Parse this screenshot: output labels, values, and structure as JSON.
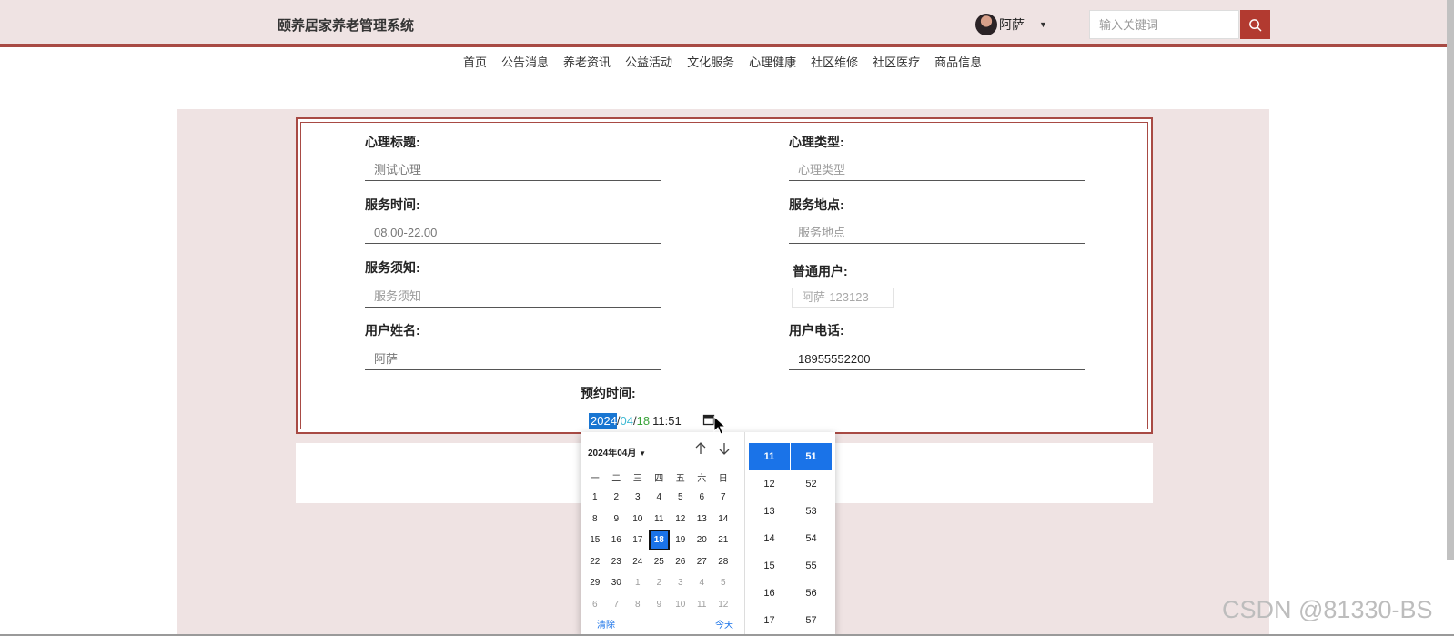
{
  "header": {
    "brand": "颐养居家养老管理系统",
    "username": "阿萨",
    "search_placeholder": "输入关键词"
  },
  "nav": [
    "首页",
    "公告消息",
    "养老资讯",
    "公益活动",
    "文化服务",
    "心理健康",
    "社区维修",
    "社区医疗",
    "商品信息"
  ],
  "form": {
    "title_label": "心理标题:",
    "title_value": "测试心理",
    "type_label": "心理类型:",
    "type_placeholder": "心理类型",
    "time_label": "服务时间:",
    "time_value": "08.00-22.00",
    "location_label": "服务地点:",
    "location_placeholder": "服务地点",
    "notice_label": "服务须知:",
    "notice_placeholder": "服务须知",
    "user_label": "普通用户:",
    "user_value": "阿萨-123123",
    "name_label": "用户姓名:",
    "name_value": "阿萨",
    "phone_label": "用户电话:",
    "phone_value": "18955552200",
    "appt_label": "预约时间:",
    "appt_year": "2024",
    "appt_month": "04",
    "appt_day": "18",
    "appt_time": "11:51"
  },
  "picker": {
    "month_label": "2024年04月",
    "weekdays": [
      "一",
      "二",
      "三",
      "四",
      "五",
      "六",
      "日"
    ],
    "days": [
      {
        "d": "1"
      },
      {
        "d": "2"
      },
      {
        "d": "3"
      },
      {
        "d": "4"
      },
      {
        "d": "5"
      },
      {
        "d": "6"
      },
      {
        "d": "7"
      },
      {
        "d": "8"
      },
      {
        "d": "9"
      },
      {
        "d": "10"
      },
      {
        "d": "11"
      },
      {
        "d": "12"
      },
      {
        "d": "13"
      },
      {
        "d": "14"
      },
      {
        "d": "15"
      },
      {
        "d": "16"
      },
      {
        "d": "17"
      },
      {
        "d": "18",
        "selected": true
      },
      {
        "d": "19"
      },
      {
        "d": "20"
      },
      {
        "d": "21"
      },
      {
        "d": "22"
      },
      {
        "d": "23"
      },
      {
        "d": "24"
      },
      {
        "d": "25"
      },
      {
        "d": "26"
      },
      {
        "d": "27"
      },
      {
        "d": "28"
      },
      {
        "d": "29"
      },
      {
        "d": "30"
      },
      {
        "d": "1",
        "other": true
      },
      {
        "d": "2",
        "other": true
      },
      {
        "d": "3",
        "other": true
      },
      {
        "d": "4",
        "other": true
      },
      {
        "d": "5",
        "other": true
      },
      {
        "d": "6",
        "other": true
      },
      {
        "d": "7",
        "other": true
      },
      {
        "d": "8",
        "other": true
      },
      {
        "d": "9",
        "other": true
      },
      {
        "d": "10",
        "other": true
      },
      {
        "d": "11",
        "other": true
      },
      {
        "d": "12",
        "other": true
      }
    ],
    "clear_label": "清除",
    "today_label": "今天",
    "hours": [
      "11",
      "12",
      "13",
      "14",
      "15",
      "16",
      "17"
    ],
    "minutes": [
      "51",
      "52",
      "53",
      "54",
      "55",
      "56",
      "57"
    ],
    "selected_hour": "11",
    "selected_minute": "51"
  },
  "watermark": "CSDN @81330-BS",
  "colors": {
    "header_bg": "#efe3e3",
    "accent": "#a84a44",
    "search_button": "#b23a30",
    "picker_selected": "#1a73e8"
  }
}
